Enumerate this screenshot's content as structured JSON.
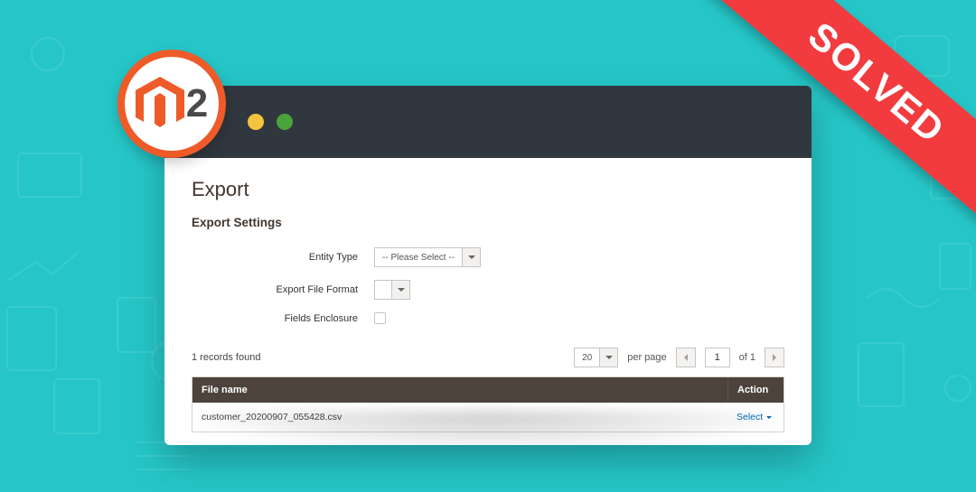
{
  "badge": {
    "text": "2"
  },
  "ribbon": {
    "text": "SOLVED"
  },
  "page": {
    "title": "Export",
    "section_title": "Export Settings"
  },
  "form": {
    "entity_type": {
      "label": "Entity Type",
      "value": "-- Please Select --"
    },
    "export_file_format": {
      "label": "Export File Format",
      "value": ""
    },
    "fields_enclosure": {
      "label": "Fields Enclosure"
    }
  },
  "grid_toolbar": {
    "records_found": "1 records found",
    "per_page_value": "20",
    "per_page_label": "per page",
    "current_page": "1",
    "of_total": "of 1"
  },
  "grid": {
    "columns": {
      "file_name": "File name",
      "action": "Action"
    },
    "rows": [
      {
        "file_name": "customer_20200907_055428.csv",
        "action_label": "Select"
      }
    ]
  },
  "colors": {
    "accent": "#ee5b29",
    "ribbon": "#f23b3e",
    "link": "#006bb4"
  }
}
